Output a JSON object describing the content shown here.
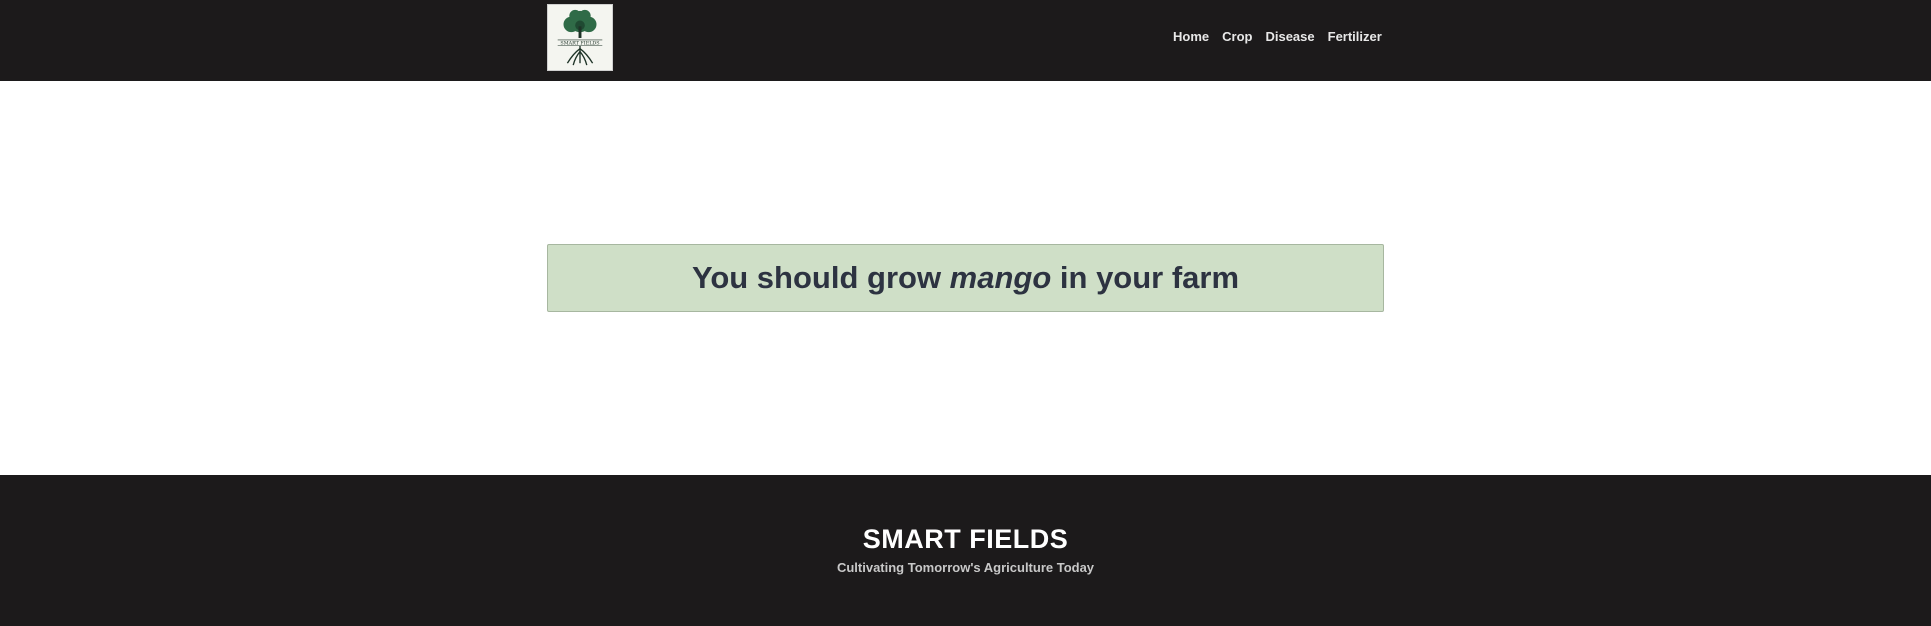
{
  "header": {
    "logo_icon": "tree-logo-icon",
    "logo_text": "SMART FIELDS",
    "nav": [
      {
        "label": "Home"
      },
      {
        "label": "Crop"
      },
      {
        "label": "Disease"
      },
      {
        "label": "Fertilizer"
      }
    ]
  },
  "main": {
    "result_prefix": "You should grow ",
    "crop": "mango",
    "result_suffix": " in your farm"
  },
  "footer": {
    "title": "SMART FIELDS",
    "tagline": "Cultivating Tomorrow's Agriculture Today"
  },
  "colors": {
    "header_bg": "#1c1a1b",
    "result_bg": "#cfdfc7",
    "result_text": "#2d3341",
    "footer_bg": "#1c1a1b"
  }
}
